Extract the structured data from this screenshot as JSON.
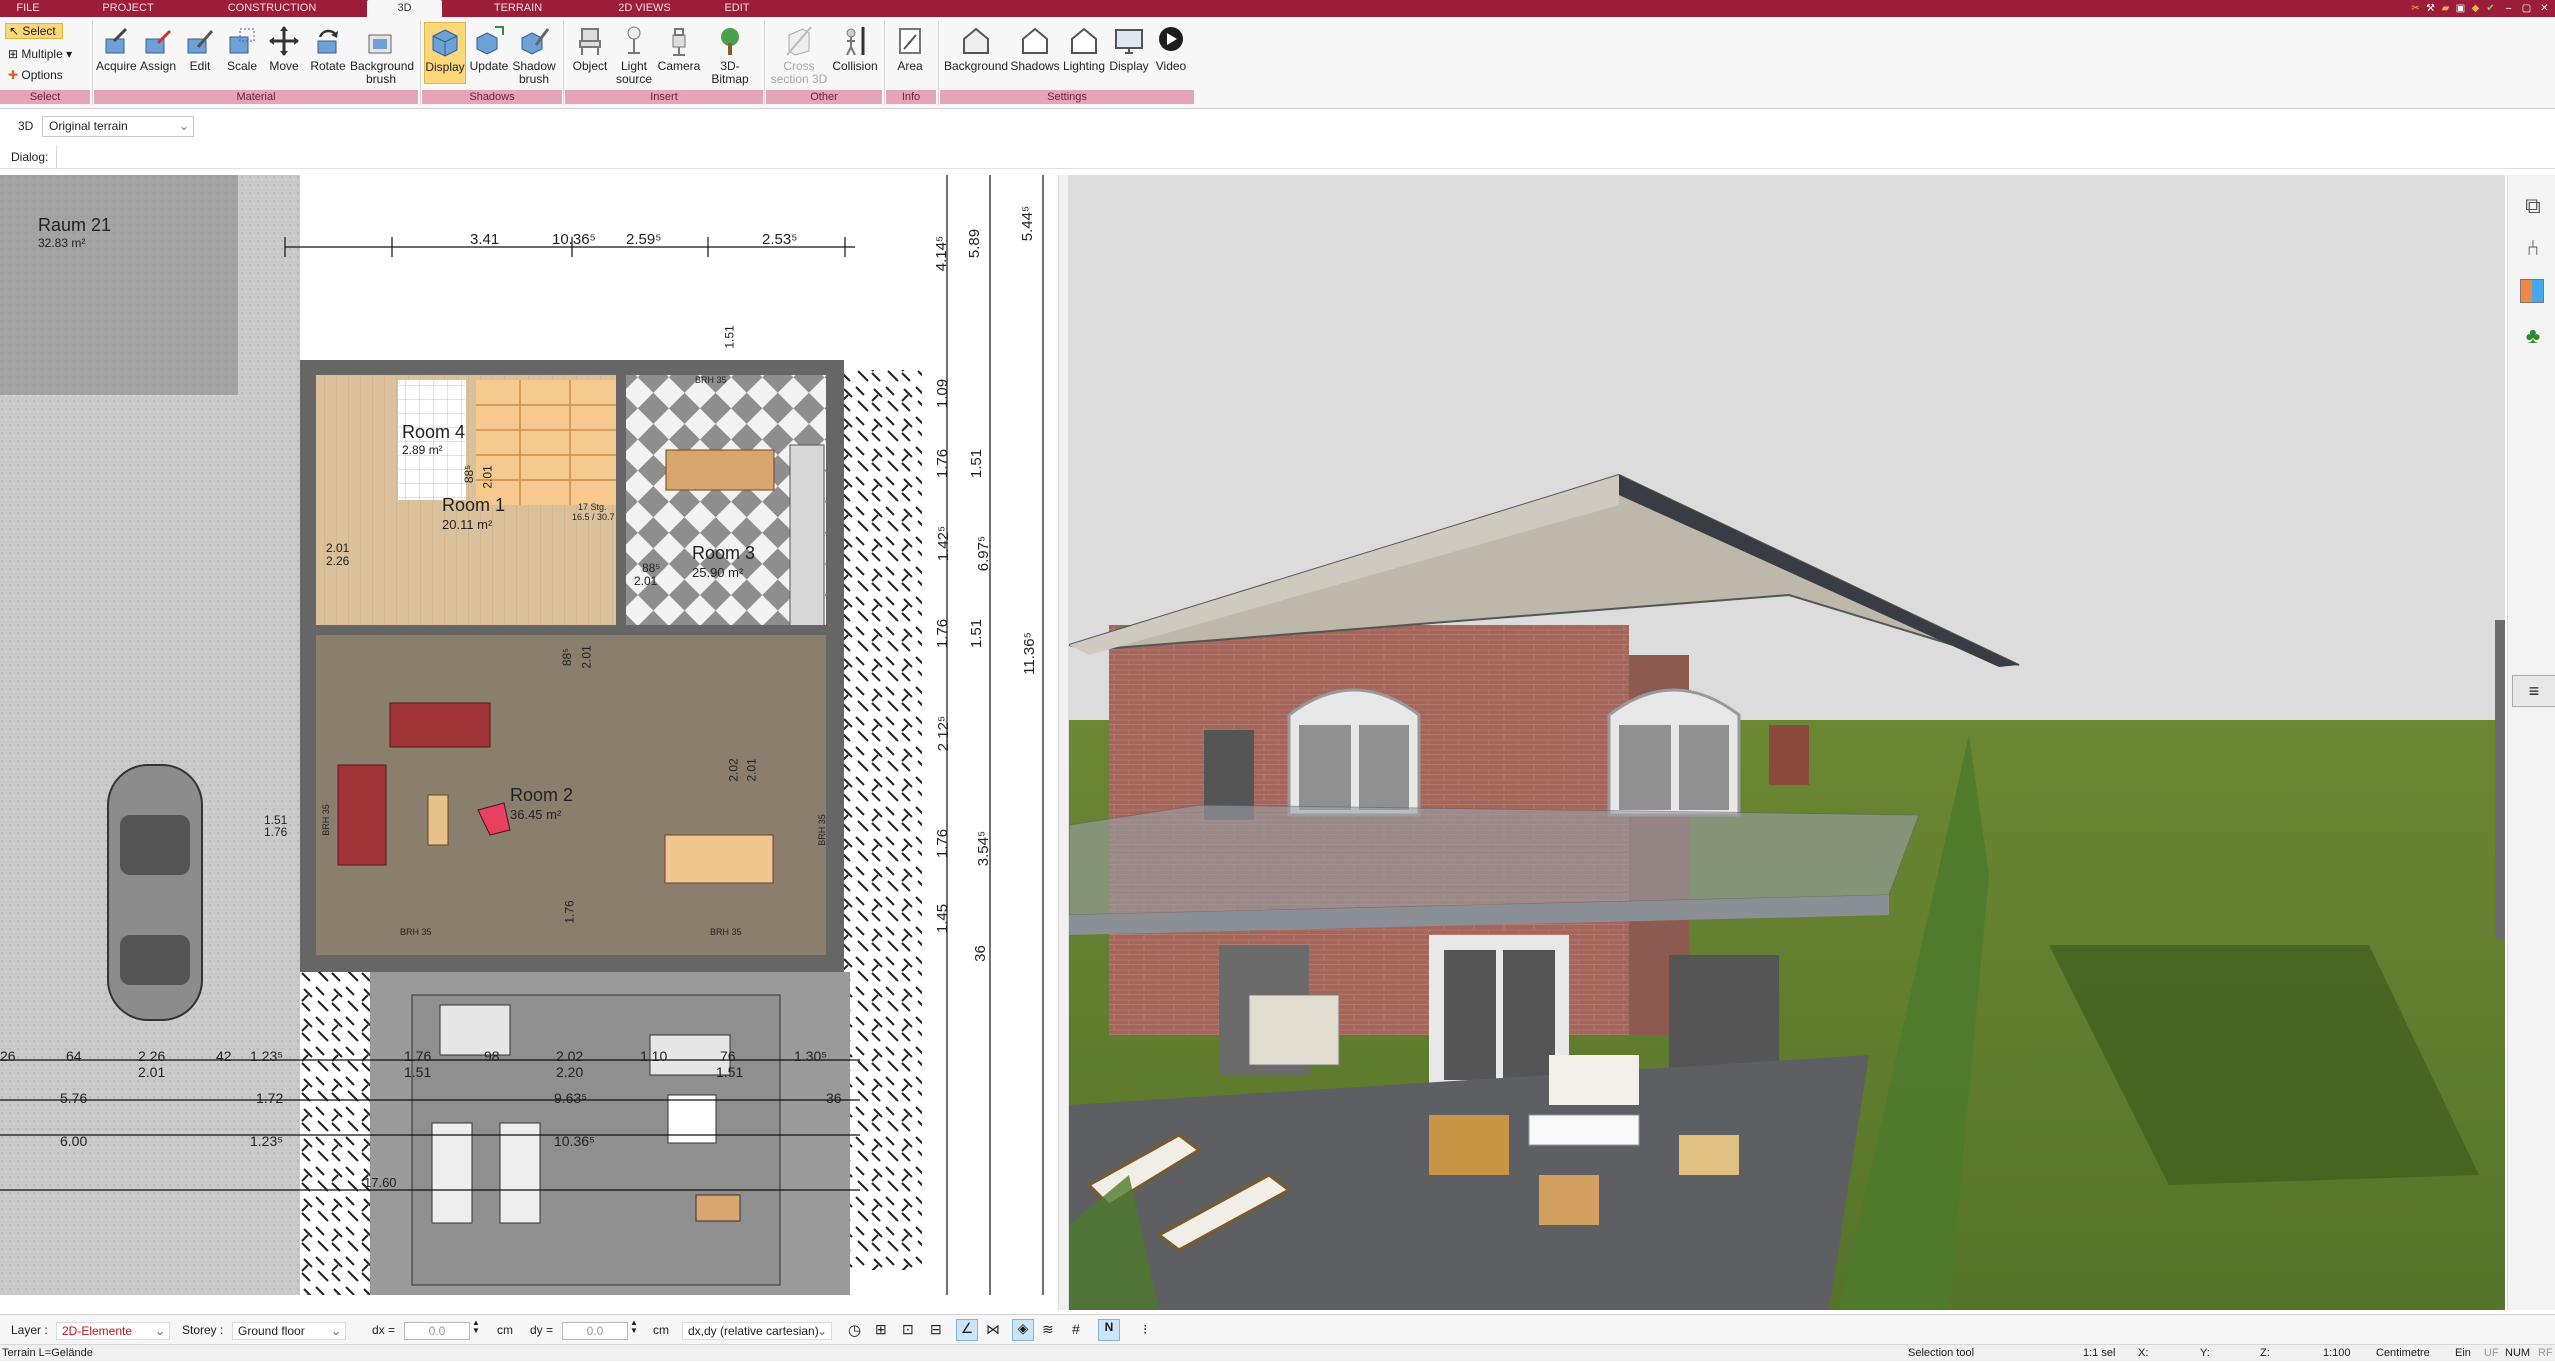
{
  "menu": {
    "tabs": [
      "FILE",
      "PROJECT",
      "CONSTRUCTION",
      "3D",
      "TERRAIN",
      "2D VIEWS",
      "EDIT"
    ],
    "active_tab": "3D"
  },
  "ribbon": {
    "select_group": {
      "select_label": "Select",
      "multiple_label": "Multiple",
      "options_label": "Options",
      "group_label": "Select"
    },
    "material": {
      "buttons": [
        "Acquire",
        "Assign",
        "Edit",
        "Scale",
        "Move",
        "Rotate",
        "Background\nbrush"
      ],
      "group_label": "Material"
    },
    "shadows": {
      "buttons": [
        "Display",
        "Update",
        "Shadow\nbrush"
      ],
      "group_label": "Shadows"
    },
    "insert": {
      "buttons": [
        "Object",
        "Light\nsource",
        "Camera",
        "3D-Bitmap"
      ],
      "group_label": "Insert"
    },
    "other": {
      "buttons": [
        "Cross\nsection 3D",
        "Collision"
      ],
      "group_label": "Other"
    },
    "info": {
      "buttons": [
        "Area"
      ],
      "group_label": "Info"
    },
    "settings": {
      "buttons": [
        "Background",
        "Shadows",
        "Lighting",
        "Display",
        "Video"
      ],
      "group_label": "Settings"
    }
  },
  "toolbar2": {
    "mode_label": "3D",
    "terrain_select_value": "Original terrain"
  },
  "dialog_bar": {
    "label": "Dialog:"
  },
  "plan": {
    "room_labels": [
      {
        "name": "Raum 21",
        "area": "32.83 m²"
      },
      {
        "name": "Room 4",
        "area": "2.89 m²"
      },
      {
        "name": "Room 1",
        "area": "20.11 m²"
      },
      {
        "name": "Room 3",
        "area": "25.90 m²"
      },
      {
        "name": "Room 2",
        "area": "36.45 m²"
      }
    ],
    "dims_top": [
      "3.41",
      "10.36⁵",
      "2.59⁵",
      "2.53⁵"
    ],
    "dims_right": [
      "5.89",
      "5.44⁵",
      "4.14⁵",
      "1.09",
      "1.76",
      "1.51",
      "1.42⁵",
      "6.97⁵",
      "1.76",
      "1.51",
      "11.36⁵",
      "2.12⁵",
      "1.76",
      "3.54⁵",
      "1.45",
      "36"
    ],
    "dims_bottom_row1": [
      "26",
      "64",
      "2.26",
      "42",
      "1.23⁵",
      "1.76",
      "98",
      "2.02",
      "1.10",
      "76",
      "1.30⁵"
    ],
    "dims_bottom_row2": [
      "2.01",
      "1.51",
      "2.20",
      "1.51"
    ],
    "dims_misc": [
      "5.76",
      "1.72",
      "9.63⁵",
      "36",
      "6.00",
      "1.23⁵",
      "10.36⁵",
      "17.60"
    ],
    "brh_labels": [
      "BRH 35",
      "BRH 35",
      "BRH 35",
      "BRH 35",
      "BRH 35"
    ],
    "door_dims": [
      "2.01",
      "2.26",
      "88⁵",
      "2.01",
      "17 Stg.",
      "16.5 / 30.7",
      "2.01",
      "88⁵",
      "2.01",
      "88⁵",
      "2.01",
      "2.02",
      "1.76",
      "1.51",
      "1.76",
      "1.51"
    ]
  },
  "statusbar": {
    "layer_label": "Layer :",
    "layer_value": "2D-Elemente",
    "storey_label": "Storey :",
    "storey_value": "Ground floor",
    "dx_label": "dx =",
    "dx_value": "0.0",
    "dx_unit": "cm",
    "dy_label": "dy =",
    "dy_value": "0.0",
    "dy_unit": "cm",
    "coord_mode": "dx,dy (relative cartesian)"
  },
  "bottombar": {
    "terrain": "Terrain L=Gelände",
    "tool": "Selection tool",
    "sel": "1:1 sel",
    "x": "X:",
    "y": "Y:",
    "z": "Z:",
    "scale": "1:100",
    "unit": "Centimetre",
    "ein": "Ein",
    "uf": "UF",
    "num": "NUM",
    "rf": "RF"
  },
  "colors": {
    "menubar": "#9c1d3a",
    "group_bar": "#e6a5b6",
    "active_button": "#fbd77b",
    "brick": "#a4655a",
    "grass": "#5d7a2c",
    "sky": "#dcdcdc"
  }
}
